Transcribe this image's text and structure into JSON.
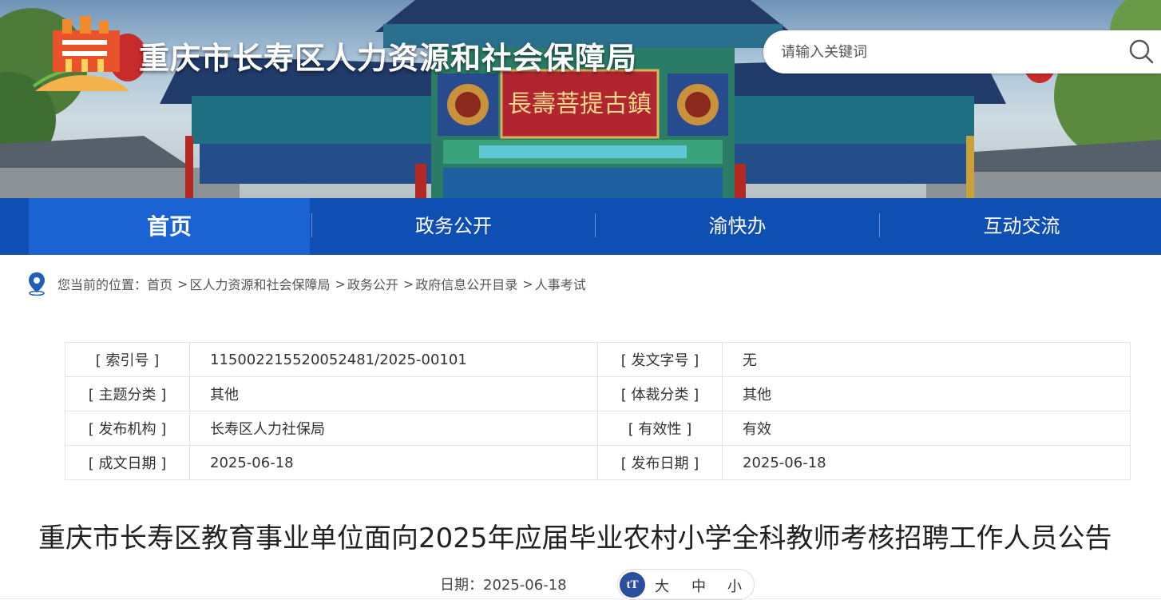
{
  "header": {
    "site_title": "重庆市长寿区人力资源和社会保障局",
    "plaque_text": "長壽菩提古鎮",
    "search_placeholder": "请输入关键词"
  },
  "nav": {
    "items": [
      {
        "label": "首页",
        "active": true
      },
      {
        "label": "政务公开",
        "active": false
      },
      {
        "label": "渝快办",
        "active": false
      },
      {
        "label": "互动交流",
        "active": false
      }
    ]
  },
  "breadcrumb": {
    "prefix": "您当前的位置：",
    "items": [
      "首页",
      "区人力资源和社会保障局",
      "政务公开",
      "政府信息公开目录",
      "人事考试"
    ],
    "separator": ">"
  },
  "meta_table": {
    "rows": [
      {
        "k1": "[ 索引号 ]",
        "v1": "11500221552005248​1/2025-00101",
        "k2": "[ 发文字号 ]",
        "v2": "无"
      },
      {
        "k1": "[ 主题分类 ]",
        "v1": "其他",
        "k2": "[ 体裁分类 ]",
        "v2": "其他"
      },
      {
        "k1": "[ 发布机构 ]",
        "v1": "长寿区人力社保局",
        "k2": "[ 有效性 ]",
        "v2": "有效"
      },
      {
        "k1": "[ 成文日期 ]",
        "v1": "2025-06-18",
        "k2": "[ 发布日期 ]",
        "v2": "2025-06-18"
      }
    ]
  },
  "article": {
    "title": "重庆市长寿区教育事业单位面向2025年应届毕业农村小学全科教师考核招聘工作人员公告",
    "date_label": "日期：",
    "date": "2025-06-18",
    "font_icon": "tT",
    "font_sizes": [
      "大",
      "中",
      "小"
    ]
  },
  "colors": {
    "nav_bg": "#0f4fb4",
    "nav_active": "#1b63d2",
    "font_icon_bg": "#2c4f9d"
  },
  "icons": [
    "logo-emblem",
    "search-icon",
    "location-pin-icon",
    "font-size-icon"
  ]
}
